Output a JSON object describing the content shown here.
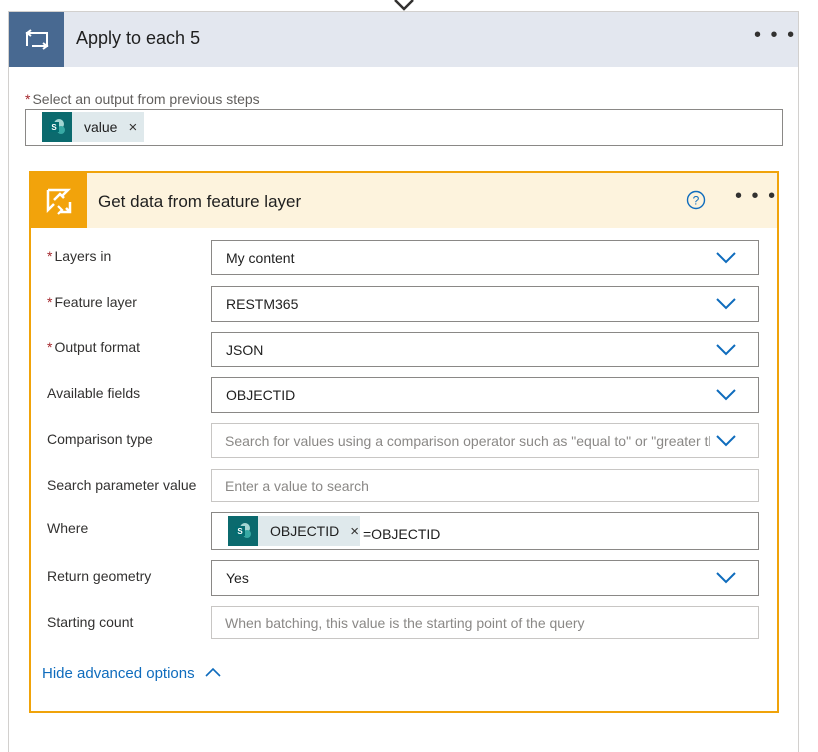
{
  "loop": {
    "title": "Apply to each 5",
    "more": "• • •",
    "select_label": "Select an output from previous steps",
    "required_mark": "*",
    "token": {
      "label": "value",
      "remove": "×",
      "icon": "sharepoint-icon"
    },
    "icon": "loop-icon"
  },
  "action": {
    "title": "Get data from feature layer",
    "more": "• • •",
    "icon": "arcgis-icon",
    "help_icon": "help-icon",
    "fields": {
      "layers_in": {
        "label": "Layers in",
        "value": "My content"
      },
      "feature_layer": {
        "label": "Feature layer",
        "value": "RESTM365"
      },
      "output_format": {
        "label": "Output format",
        "value": "JSON"
      },
      "available_fields": {
        "label": "Available fields",
        "value": "OBJECTID"
      },
      "comparison_type": {
        "label": "Comparison type",
        "placeholder": "Search for values using a comparison operator such as \"equal to\" or \"greater than\""
      },
      "search_param": {
        "label": "Search parameter value",
        "placeholder": "Enter a value to search"
      },
      "where": {
        "label": "Where",
        "token_label": "OBJECTID",
        "token_remove": "×",
        "suffix": "=OBJECTID"
      },
      "return_geometry": {
        "label": "Return geometry",
        "value": "Yes"
      },
      "starting_count": {
        "label": "Starting count",
        "placeholder": "When batching, this value is the starting point of the query"
      }
    },
    "hide_advanced": "Hide advanced options"
  },
  "colors": {
    "loop_icon_bg": "#486991",
    "action_icon_bg": "#f2a30b",
    "action_border": "#f0a30a",
    "link": "#0f6cbd",
    "required": "#a4262c"
  }
}
